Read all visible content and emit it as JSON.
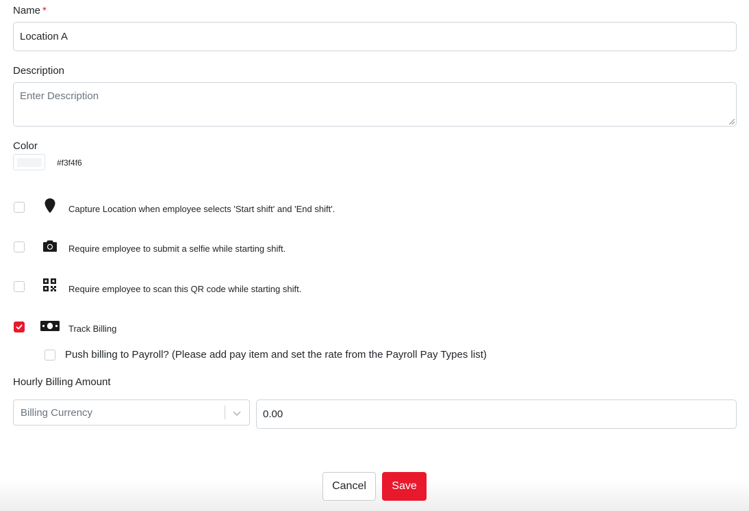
{
  "name": {
    "label": "Name",
    "required_mark": "*",
    "value": "Location A"
  },
  "description": {
    "label": "Description",
    "placeholder": "Enter Description"
  },
  "color": {
    "label": "Color",
    "value": "#f3f4f6"
  },
  "options": [
    {
      "label": "Capture Location when employee selects 'Start shift' and 'End shift'.",
      "icon": "map-pin-icon",
      "checked": false
    },
    {
      "label": "Require employee to submit a selfie while starting shift.",
      "icon": "camera-icon",
      "checked": false
    },
    {
      "label": "Require employee to scan this QR code while starting shift.",
      "icon": "qr-code-icon",
      "checked": false
    },
    {
      "label": "Track Billing",
      "icon": "money-bill-icon",
      "checked": true
    }
  ],
  "push_billing": {
    "label": "Push billing to Payroll? (Please add pay item and set the rate from the Payroll Pay Types list)",
    "checked": false
  },
  "hourly_billing": {
    "label": "Hourly Billing Amount",
    "currency_placeholder": "Billing Currency",
    "amount": "0.00"
  },
  "buttons": {
    "cancel": "Cancel",
    "save": "Save"
  },
  "colors": {
    "accent": "#e8192c",
    "border": "#ced4da"
  }
}
